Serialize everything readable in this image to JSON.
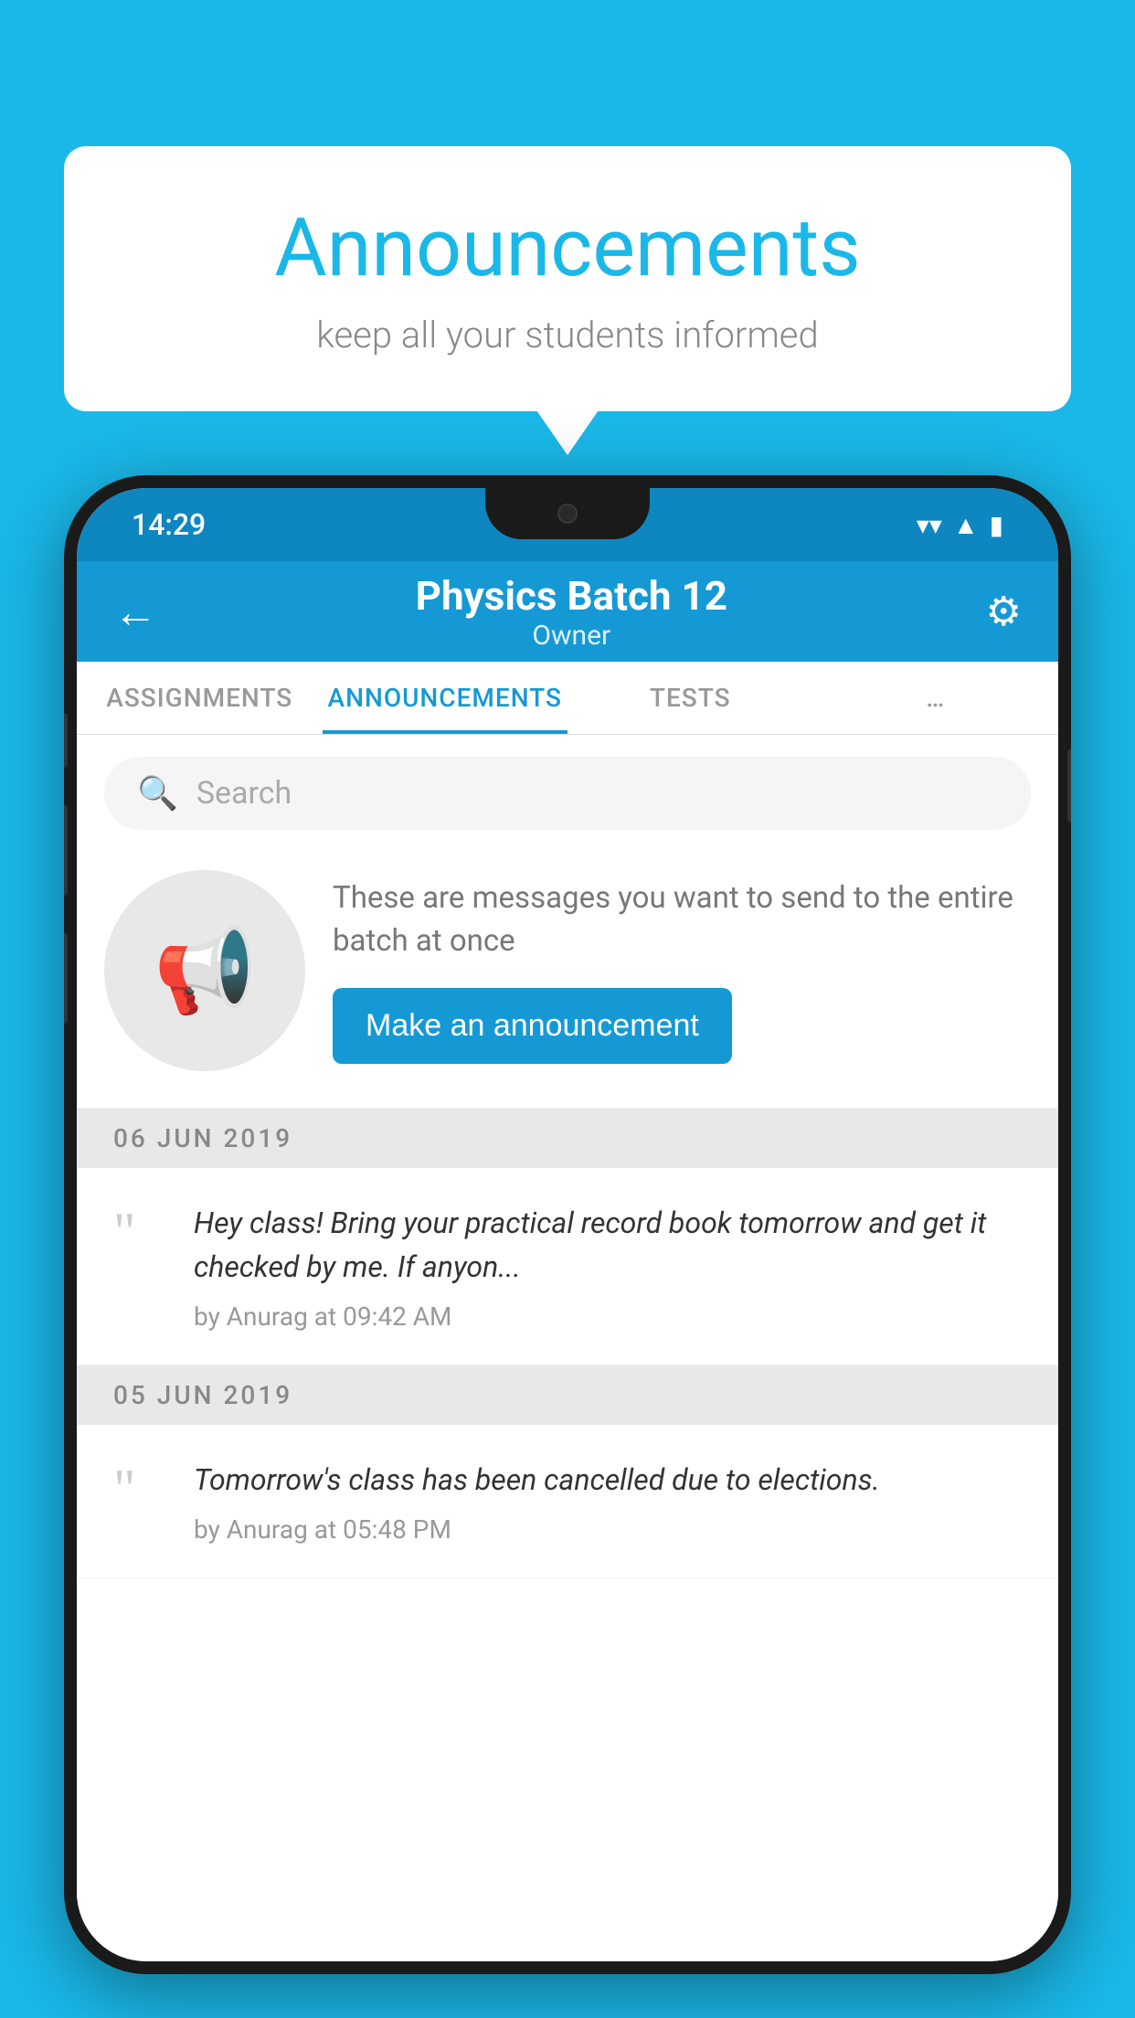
{
  "background_color": "#1ab8e8",
  "speech_bubble": {
    "title": "Announcements",
    "subtitle": "keep all your students informed"
  },
  "phone": {
    "status_bar": {
      "time": "14:29",
      "icons": [
        "wifi",
        "signal",
        "battery"
      ]
    },
    "header": {
      "title": "Physics Batch 12",
      "subtitle": "Owner",
      "back_label": "←",
      "settings_label": "⚙"
    },
    "tabs": [
      {
        "label": "ASSIGNMENTS",
        "active": false
      },
      {
        "label": "ANNOUNCEMENTS",
        "active": true
      },
      {
        "label": "TESTS",
        "active": false
      },
      {
        "label": "…",
        "active": false
      }
    ],
    "search": {
      "placeholder": "Search"
    },
    "promo": {
      "description": "These are messages you want to send to the entire batch at once",
      "button_label": "Make an announcement"
    },
    "announcements": [
      {
        "date": "06  JUN  2019",
        "text": "Hey class! Bring your practical record book tomorrow and get it checked by me. If anyon...",
        "meta": "by Anurag at 09:42 AM"
      },
      {
        "date": "05  JUN  2019",
        "text": "Tomorrow's class has been cancelled due to elections.",
        "meta": "by Anurag at 05:48 PM"
      }
    ]
  }
}
